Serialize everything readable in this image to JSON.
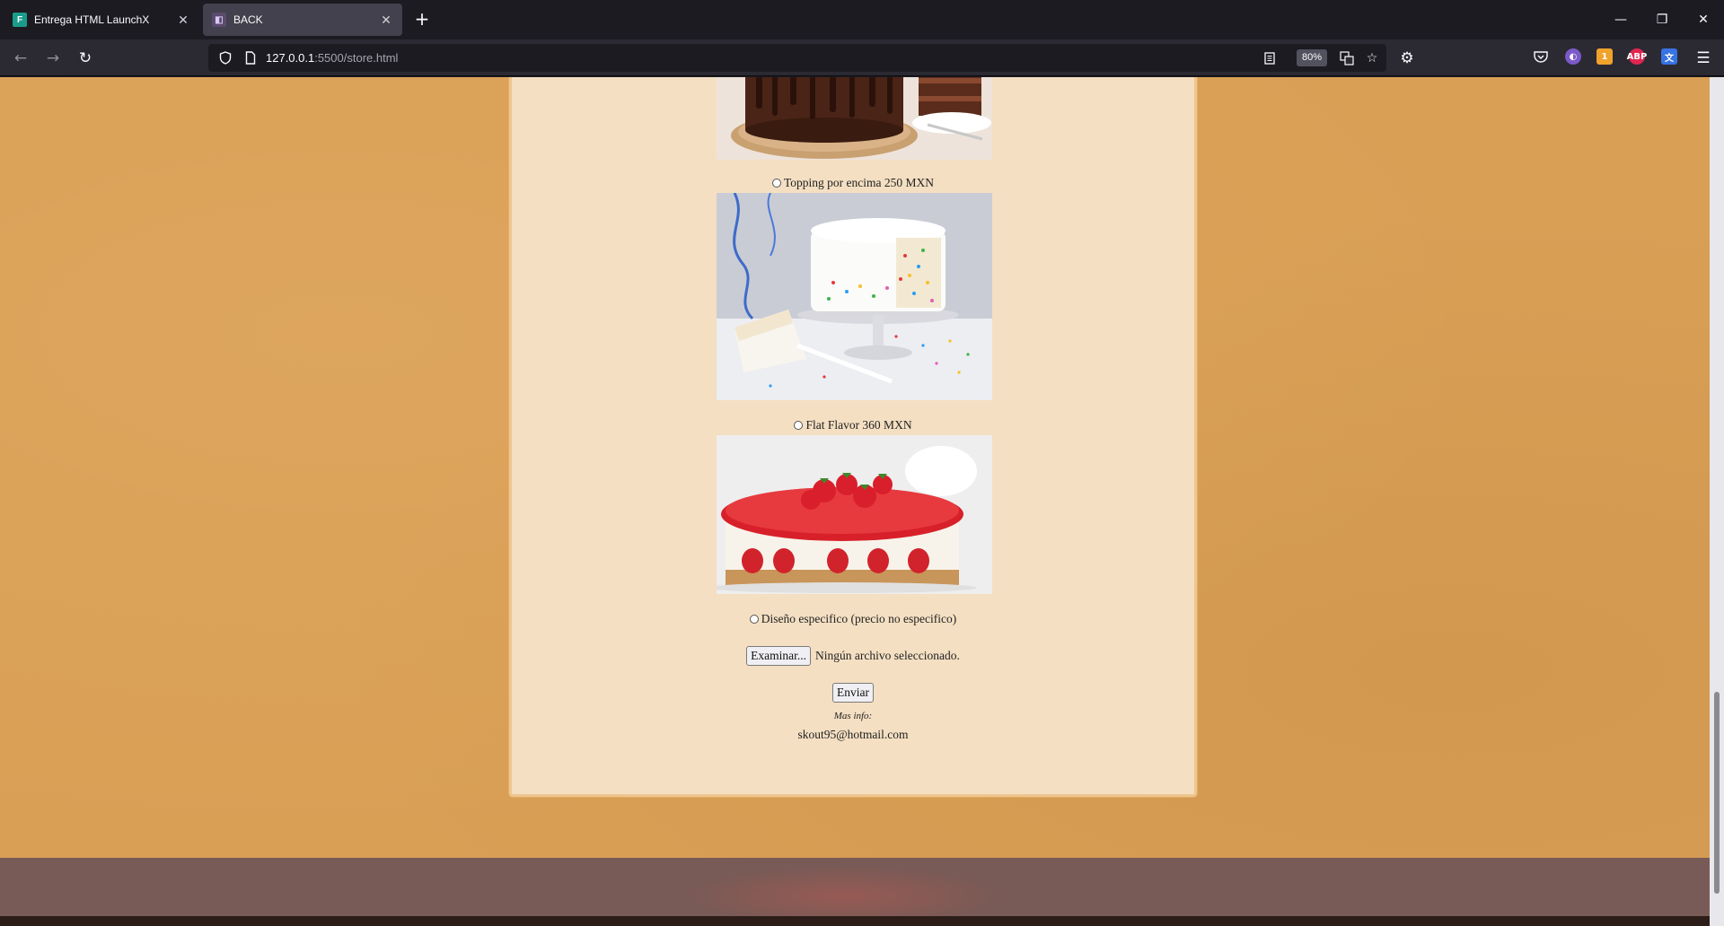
{
  "browser": {
    "tabs": [
      {
        "title": "Entrega HTML LaunchX",
        "active": false,
        "favicon": "launchx-icon"
      },
      {
        "title": "BACK",
        "active": true,
        "favicon": "back-icon"
      }
    ],
    "url_host": "127.0.0.1",
    "url_rest": ":5500/store.html",
    "zoom": "80%"
  },
  "page": {
    "options": [
      {
        "label": "Topping por encima 250 MXN",
        "image": "rainbow-sprinkle-cake"
      },
      {
        "label": "Flat Flavor 360 MXN",
        "image": "strawberry-cheesecake"
      },
      {
        "label": "Diseño especifico (precio no especifico)"
      }
    ],
    "file_button": "Examinar...",
    "file_status": "Ningún archivo seleccionado.",
    "submit_label": "Enviar",
    "info_label": "Mas info:",
    "email": "skout95@hotmail.com"
  },
  "colors": {
    "page_background": "#d99f55",
    "card_background": "#f4dfc2",
    "footer": "#785a56"
  }
}
